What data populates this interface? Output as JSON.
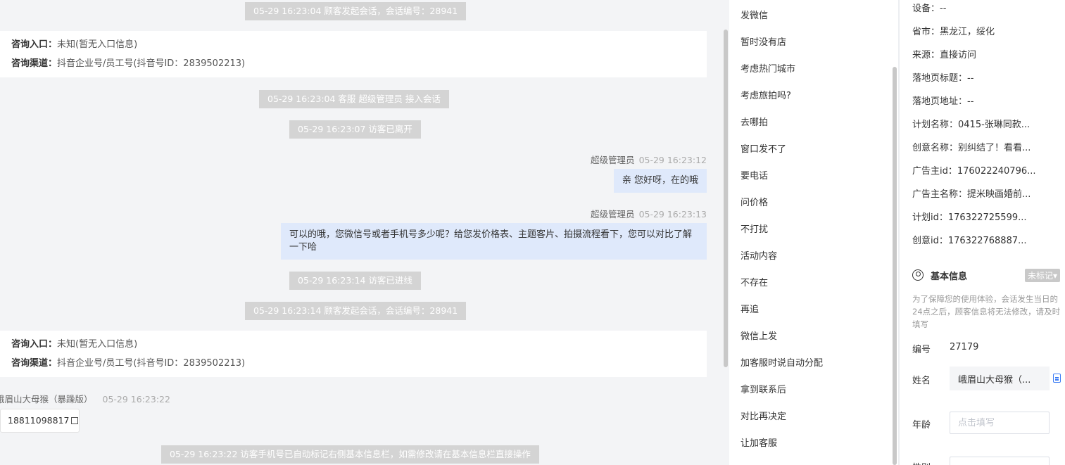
{
  "chat": {
    "sys1": "05-29 16:23:04 顾客发起会话，会话编号：28941",
    "card1": {
      "entry_label": "咨询入口：",
      "entry_value": "未知(暂无入口信息)",
      "channel_label": "咨询渠道：",
      "channel_value": "抖音企业号/员工号(抖音号ID：2839502213)"
    },
    "sys2": "05-29 16:23:04 客服 超级管理员 接入会话",
    "sys3": "05-29 16:23:07 访客已离开",
    "msg1": {
      "sender": "超级管理员",
      "time": "05-29 16:23:12",
      "text": "亲 您好呀，在的哦"
    },
    "msg2": {
      "sender": "超级管理员",
      "time": "05-29 16:23:13",
      "text": "可以的哦，您微信号或者手机号多少呢？给您发价格表、主题客片、拍摄流程看下，您可以对比了解一下哈"
    },
    "sys4": "05-29 16:23:14 访客已进线",
    "sys5": "05-29 16:23:14 顾客发起会话，会话编号：28941",
    "card2": {
      "entry_label": "咨询入口：",
      "entry_value": "未知(暂无入口信息)",
      "channel_label": "咨询渠道：",
      "channel_value": "抖音企业号/员工号(抖音号ID：2839502213)"
    },
    "visitor": {
      "name": "峨眉山大母猴（暴躁版）",
      "time": "05-29 16:23:22",
      "phone": "18811098817"
    },
    "sys6": "05-29 16:23:22 访客手机号已自动标记右侧基本信息栏，如需修改请在基本信息栏直接操作"
  },
  "quick_replies": [
    "发微信",
    "暂时没有店",
    "考虑热门城市",
    "考虑旅拍吗?",
    "去哪拍",
    "窗口发不了",
    "要电话",
    "问价格",
    "不打扰",
    "活动内容",
    "不存在",
    "再追",
    "微信上发",
    "加客服时说自动分配",
    "拿到联系后",
    "对比再决定",
    "让加客服"
  ],
  "info": {
    "device": "设备：--",
    "province": "省市：黑龙江，绥化",
    "source": "来源：直接访问",
    "landing_title": "落地页标题：--",
    "landing_url": "落地页地址：--",
    "plan_name": "计划名称：0415-张琳同款...",
    "creative_name": "创意名称：别纠结了！看看...",
    "advertiser_id": "广告主id：176022240796...",
    "advertiser_name": "广告主名称：提米映画婚前...",
    "plan_id": "计划id：176322725599...",
    "creative_id": "创意id：176322768887...",
    "section_title": "基本信息",
    "tag": "未标记▾",
    "notice": "为了保障您的使用体验，会话发生当日的24点之后，顾客信息将无法修改，请及时填写",
    "number_label": "编号",
    "number_value": "27179",
    "name_label": "姓名",
    "name_value": "峨眉山大母猴（...",
    "age_label": "年龄",
    "age_placeholder": "点击填写",
    "gender_label": "性别"
  }
}
